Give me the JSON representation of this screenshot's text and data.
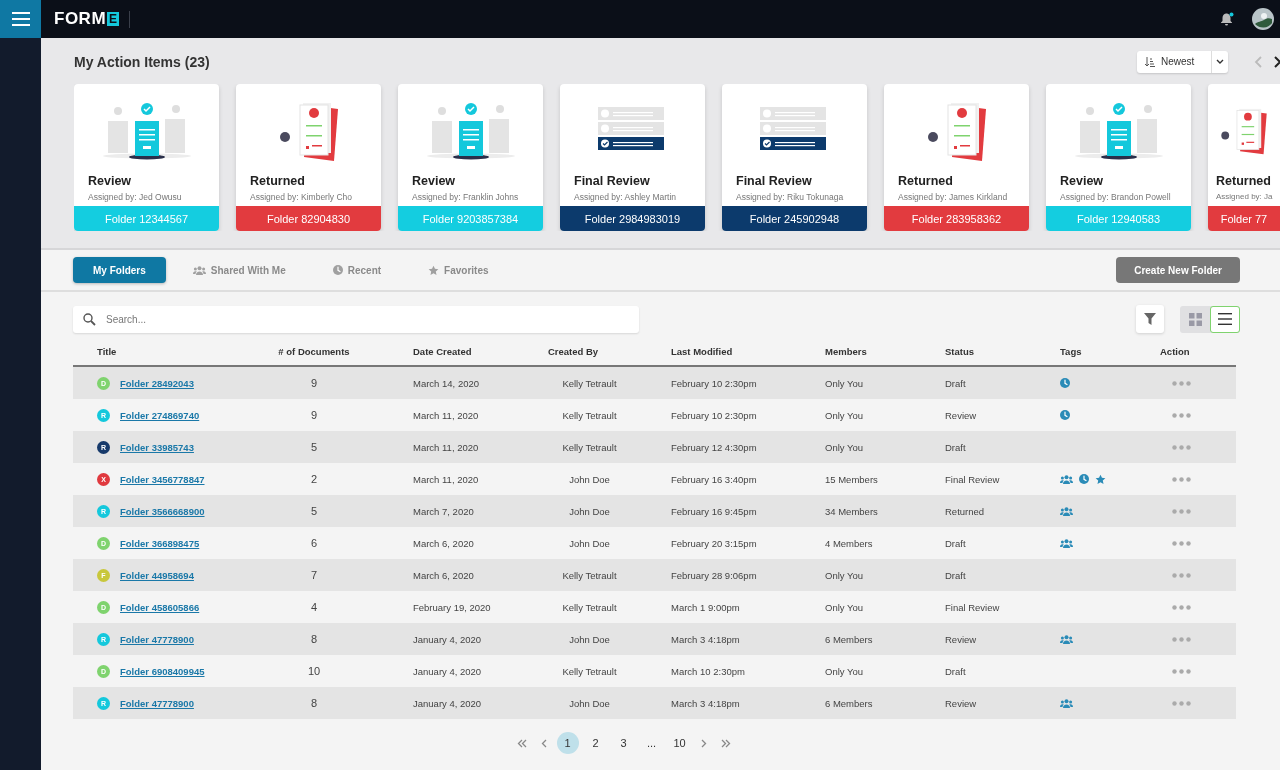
{
  "logo": {
    "text": "FORM",
    "mark": "E"
  },
  "action_items": {
    "title": "My Action Items (23)",
    "sort": {
      "value": "Newest"
    },
    "cards": [
      {
        "kind": "review",
        "title": "Review",
        "assigned": "Assigned by: Jed Owusu",
        "folder": "Folder 12344567"
      },
      {
        "kind": "returned",
        "title": "Returned",
        "assigned": "Assigned by: Kimberly Cho",
        "folder": "Folder 82904830"
      },
      {
        "kind": "review",
        "title": "Review",
        "assigned": "Assigned by: Franklin Johns",
        "folder": "Folder 9203857384"
      },
      {
        "kind": "final_review",
        "title": "Final Review",
        "assigned": "Assigned by: Ashley Martin",
        "folder": "Folder 2984983019"
      },
      {
        "kind": "final_review",
        "title": "Final Review",
        "assigned": "Assigned by: Riku Tokunaga",
        "folder": "Folder 245902948"
      },
      {
        "kind": "returned",
        "title": "Returned",
        "assigned": "Assigned by: James Kirkland",
        "folder": "Folder 283958362"
      },
      {
        "kind": "review",
        "title": "Review",
        "assigned": "Assigned by: Brandon Powell",
        "folder": "Folder 12940583"
      },
      {
        "kind": "returned",
        "title": "Returned",
        "assigned": "Assigned by: Ja",
        "folder": "Folder 77"
      }
    ]
  },
  "tabs": [
    {
      "kind": "mine",
      "label": "My Folders",
      "selected": true
    },
    {
      "kind": "shared",
      "label": "Shared With Me",
      "selected": false
    },
    {
      "kind": "recent",
      "label": "Recent",
      "selected": false
    },
    {
      "kind": "favorites",
      "label": "Favorites",
      "selected": false
    }
  ],
  "create_button": "Create New Folder",
  "search": {
    "placeholder": "Search..."
  },
  "view_toggle": [
    {
      "kind": "grid",
      "selected": false
    },
    {
      "kind": "list",
      "selected": true
    }
  ],
  "table": {
    "columns": [
      "Title",
      "# of Documents",
      "Date Created",
      "Created By",
      "Last Modified",
      "Members",
      "Status",
      "Tags",
      "Action"
    ],
    "rows": [
      {
        "badge": "D",
        "color": "#7fd36e",
        "title": "Folder 28492043",
        "documents": "9",
        "date_created": "March 14, 2020",
        "created_by": "Kelly Tetrault",
        "last_modified": "February 10 2:30pm",
        "members": "Only You",
        "status": "Draft",
        "tags": [
          {
            "kind": "recent"
          }
        ]
      },
      {
        "badge": "R",
        "color": "#14c8dc",
        "title": "Folder 274869740",
        "documents": "9",
        "date_created": "March 11, 2020",
        "created_by": "Kelly Tetrault",
        "last_modified": "February 10 2:30pm",
        "members": "Only You",
        "status": "Review",
        "tags": [
          {
            "kind": "recent"
          }
        ]
      },
      {
        "badge": "R",
        "color": "#173a6b",
        "title": "Folder 33985743",
        "documents": "5",
        "date_created": "March 11, 2020",
        "created_by": "Kelly Tetrault",
        "last_modified": "February 12 4:30pm",
        "members": "Only You",
        "status": "Draft",
        "tags": []
      },
      {
        "badge": "X",
        "color": "#e0393e",
        "title": "Folder 3456778847",
        "documents": "2",
        "date_created": "March 11, 2020",
        "created_by": "John Doe",
        "last_modified": "February 16 3:40pm",
        "members": "15 Members",
        "status": "Final Review",
        "tags": [
          {
            "kind": "shared"
          },
          {
            "kind": "recent"
          },
          {
            "kind": "favorite"
          }
        ]
      },
      {
        "badge": "R",
        "color": "#14c8dc",
        "title": "Folder 3566668900",
        "documents": "5",
        "date_created": "March 7, 2020",
        "created_by": "John Doe",
        "last_modified": "February 16 9:45pm",
        "members": "34 Members",
        "status": "Returned",
        "tags": [
          {
            "kind": "shared"
          }
        ]
      },
      {
        "badge": "D",
        "color": "#7fd36e",
        "title": "Folder 366898475",
        "documents": "6",
        "date_created": "March 6, 2020",
        "created_by": "John Doe",
        "last_modified": "February 20 3:15pm",
        "members": "4 Members",
        "status": "Draft",
        "tags": [
          {
            "kind": "shared"
          }
        ]
      },
      {
        "badge": "F",
        "color": "#c8c73c",
        "title": "Folder 44958694",
        "documents": "7",
        "date_created": "March 6, 2020",
        "created_by": "Kelly Tetrault",
        "last_modified": "February 28 9:06pm",
        "members": "Only You",
        "status": "Draft",
        "tags": []
      },
      {
        "badge": "D",
        "color": "#7fd36e",
        "title": "Folder 458605866",
        "documents": "4",
        "date_created": "February 19, 2020",
        "created_by": "Kelly Tetrault",
        "last_modified": "March 1 9:00pm",
        "members": "Only You",
        "status": "Final Review",
        "tags": []
      },
      {
        "badge": "R",
        "color": "#14c8dc",
        "title": "Folder 47778900",
        "documents": "8",
        "date_created": "January 4, 2020",
        "created_by": "John Doe",
        "last_modified": "March 3 4:18pm",
        "members": "6 Members",
        "status": "Review",
        "tags": [
          {
            "kind": "shared"
          }
        ]
      },
      {
        "badge": "D",
        "color": "#7fd36e",
        "title": "Folder 6908409945",
        "documents": "10",
        "date_created": "January 4, 2020",
        "created_by": "Kelly Tetrault",
        "last_modified": "March 10 2:30pm",
        "members": "Only You",
        "status": "Draft",
        "tags": []
      },
      {
        "badge": "R",
        "color": "#14c8dc",
        "title": "Folder 47778900",
        "documents": "8",
        "date_created": "January 4, 2020",
        "created_by": "John Doe",
        "last_modified": "March 3 4:18pm",
        "members": "6 Members",
        "status": "Review",
        "tags": [
          {
            "kind": "shared"
          }
        ]
      }
    ]
  },
  "pagination": {
    "pages": [
      {
        "label": "1",
        "selected": true
      },
      {
        "label": "2",
        "selected": false
      },
      {
        "label": "3",
        "selected": false
      },
      {
        "label": "...",
        "selected": false
      },
      {
        "label": "10",
        "selected": false
      }
    ]
  }
}
